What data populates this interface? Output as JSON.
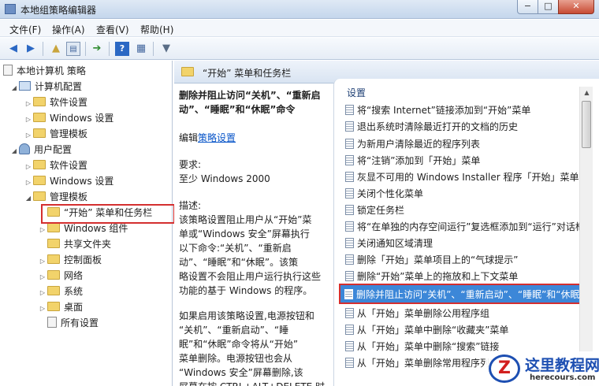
{
  "window": {
    "title": "本地组策略编辑器",
    "min": "−",
    "max": "□",
    "close": "✕"
  },
  "menu": [
    "文件(F)",
    "操作(A)",
    "查看(V)",
    "帮助(H)"
  ],
  "tree": {
    "root": "本地计算机 策略",
    "computer_config": "计算机配置",
    "c_software": "软件设置",
    "c_windows": "Windows 设置",
    "c_admin": "管理模板",
    "user_config": "用户配置",
    "u_software": "软件设置",
    "u_windows": "Windows 设置",
    "u_admin": "管理模板",
    "start_menu": "“开始” 菜单和任务栏",
    "win_components": "Windows 组件",
    "shared_folders": "共享文件夹",
    "control_panel": "控制面板",
    "network": "网络",
    "system": "系统",
    "desktop": "桌面",
    "all_settings": "所有设置"
  },
  "panel": {
    "title": "“开始” 菜单和任务栏"
  },
  "description": {
    "title_line1": "删除并阻止访问“关机”、“重新启",
    "title_line2": "动”、“睡眠”和“休眠”命令",
    "edit_prefix": "编辑",
    "edit_link": "策略设置",
    "req_label": "要求:",
    "req_value": "至少 Windows 2000",
    "desc_label": "描述:",
    "lines": [
      "该策略设置阻止用户从“开始”菜",
      "单或“Windows 安全”屏幕执行",
      "以下命令:“关机”、“重新启",
      "动”、“睡眠”和“休眠”。该策",
      "略设置不会阻止用户运行执行这些",
      "功能的基于 Windows 的程序。",
      "",
      "如果启用该策略设置,电源按钮和",
      "“关机”、“重新启动”、“睡",
      "眠”和“休眠”命令将从“开始”",
      "菜单删除。电源按钮也会从",
      "“Windows 安全”屏幕删除,该",
      "屏幕在按 CTRL+ALT+DELETE 时"
    ]
  },
  "list": {
    "header": "设置",
    "items": [
      "将“搜索 Internet”链接添加到“开始”菜单",
      "退出系统时清除最近打开的文档的历史",
      "为新用户清除最近的程序列表",
      "将“注销”添加到「开始」菜单",
      "灰显不可用的 Windows Installer 程序「开始」菜单快捷方式",
      "关闭个性化菜单",
      "锁定任务栏",
      "将“在单独的内存空间运行”复选框添加到“运行”对话框",
      "关闭通知区域清理",
      "删除「开始」菜单项目上的“气球提示”",
      "删除“开始”菜单上的拖放和上下文菜单",
      "删除并阻止访问“关机”、“重新启动”、“睡眠”和“休眠”命令",
      "从「开始」菜单删除公用程序组",
      "从「开始」菜单中删除“收藏夹”菜单",
      "从「开始」菜单中删除“搜索”链接",
      "从「开始」菜单删除常用程序列表"
    ]
  },
  "watermark": {
    "logo": "Z",
    "name": "这里教程网",
    "url": "herecours.com"
  }
}
